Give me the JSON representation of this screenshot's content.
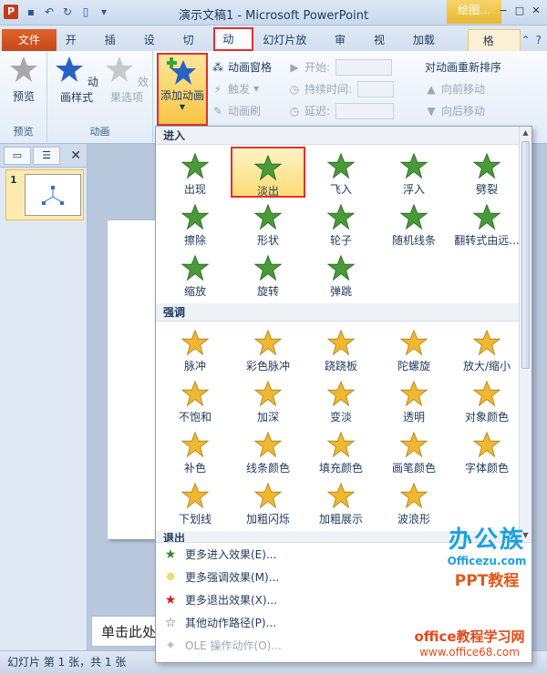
{
  "titlebar": {
    "app_icon": "P",
    "title": "演示文稿1 - Microsoft PowerPoint",
    "context_tab_title": "绘图...",
    "window_controls": [
      "−",
      "□",
      "✕"
    ]
  },
  "tabs": {
    "file": "文件",
    "items": [
      "开始",
      "插入",
      "设计",
      "切换",
      "动画",
      "幻灯片放映",
      "审阅",
      "视图",
      "加载项"
    ],
    "active": "动画",
    "format": "格式"
  },
  "ribbon": {
    "preview_group": {
      "button": "预览",
      "label": "预览"
    },
    "animation_group": {
      "style_button": "动画样式",
      "effect_options": "效果选项",
      "label": "动画"
    },
    "add_animation": "添加动画",
    "advanced": {
      "pane": "动画窗格",
      "trigger": "触发",
      "painter": "动画刷"
    },
    "timing": {
      "start": "开始:",
      "duration": "持续时间:",
      "delay": "延迟:"
    },
    "reorder": {
      "title": "对动画重新排序",
      "forward": "向前移动",
      "backward": "向后移动"
    }
  },
  "left_panel": {
    "slide_number": "1"
  },
  "notes": {
    "placeholder": "单击此处添加备注"
  },
  "statusbar": {
    "text": "幻灯片 第 1 张，共 1 张"
  },
  "gallery": {
    "sections": [
      {
        "title": "进入",
        "items": [
          "出现",
          "淡出",
          "飞入",
          "浮入",
          "劈裂",
          "擦除",
          "形状",
          "轮子",
          "随机线条",
          "翻转式由远...",
          "缩放",
          "旋转",
          "弹跳"
        ],
        "selected": "淡出"
      },
      {
        "title": "强调",
        "items": [
          "脉冲",
          "彩色脉冲",
          "跷跷板",
          "陀螺旋",
          "放大/缩小",
          "不饱和",
          "加深",
          "变淡",
          "透明",
          "对象颜色",
          "补色",
          "线条颜色",
          "填充颜色",
          "画笔颜色",
          "字体颜色",
          "下划线",
          "加粗闪烁",
          "加粗展示",
          "波浪形"
        ]
      },
      {
        "title": "退出",
        "items": []
      }
    ],
    "more": [
      {
        "label": "更多进入效果(E)...",
        "icon": "green-star-icon"
      },
      {
        "label": "更多强调效果(M)...",
        "icon": "yellow-star-icon"
      },
      {
        "label": "更多退出效果(X)...",
        "icon": "red-star-icon"
      },
      {
        "label": "其他动作路径(P)...",
        "icon": "outline-star-icon"
      },
      {
        "label": "OLE 操作动作(O)...",
        "icon": "ole-action-icon",
        "disabled": true
      }
    ]
  },
  "watermark": {
    "logo": "办公族",
    "url1": "Officezu.com",
    "ppt": "PPT教程",
    "title2": "office教程学习网",
    "url2": "www.office68.com"
  },
  "colors": {
    "enter_star": "#4a9a3a",
    "emphasis_star": "#f0b830",
    "highlight_border": "#e03030",
    "file_tab": "#d4541f"
  }
}
